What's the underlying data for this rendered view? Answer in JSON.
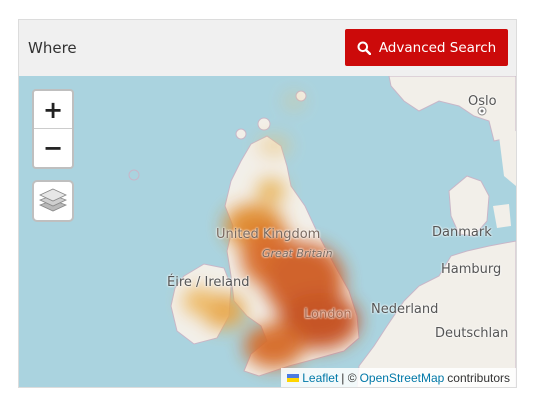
{
  "header": {
    "title": "Where",
    "search_button_label": "Advanced Search"
  },
  "map": {
    "zoom_in_label": "+",
    "zoom_out_label": "−",
    "labels": {
      "oslo": "Oslo",
      "danmark": "Danmark",
      "united_kingdom": "United Kingdom",
      "great_britain": "Great Britain",
      "eire_ireland": "Éire / Ireland",
      "hamburg": "Hamburg",
      "london": "London",
      "nederland": "Nederland",
      "deutschland": "Deutschlan"
    },
    "colors": {
      "water": "#aad3df",
      "land": "#f2efe9",
      "heat_high": "#c0501e",
      "heat_low": "#e8a040"
    }
  },
  "attribution": {
    "leaflet_label": "Leaflet",
    "separator": "| ©",
    "osm_label": "OpenStreetMap",
    "suffix": "contributors"
  }
}
